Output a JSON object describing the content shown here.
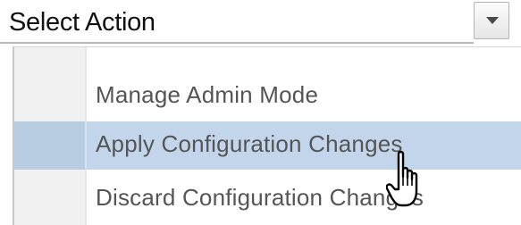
{
  "select": {
    "label": "Select Action",
    "button_icon": "chevron-down-icon"
  },
  "menu": {
    "items": [
      {
        "label": "Manage Admin Mode",
        "state": "normal"
      },
      {
        "label": "Apply Configuration Changes",
        "state": "hovered"
      },
      {
        "label": "Discard Configuration Changes",
        "state": "normal"
      }
    ]
  },
  "cursor": {
    "icon": "hand-pointer-icon"
  },
  "colors": {
    "highlight": "#c2d5ea",
    "text": "#555555",
    "gutter": "#f1f1f1"
  }
}
